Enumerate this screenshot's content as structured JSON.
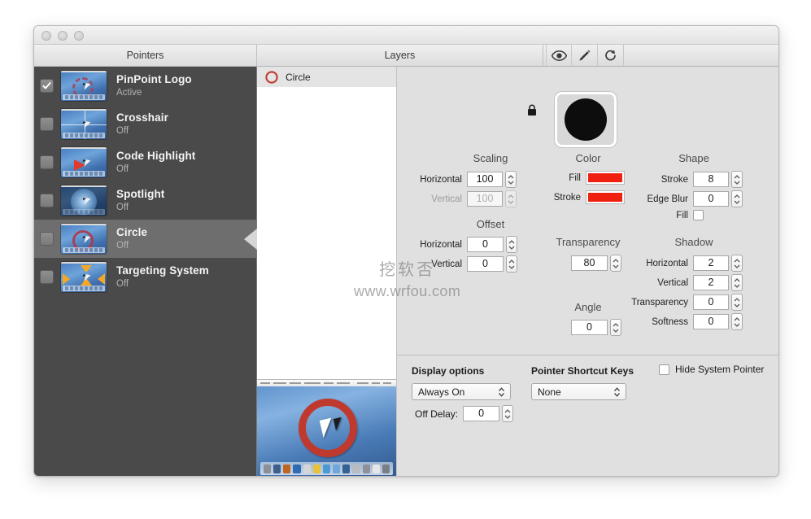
{
  "window": {
    "traffic_lights": [
      "close",
      "minimize",
      "zoom"
    ]
  },
  "header": {
    "pointers_title": "Pointers",
    "layers_title": "Layers",
    "tools": [
      {
        "name": "eye-icon",
        "label": "Preview"
      },
      {
        "name": "pencil-icon",
        "label": "Edit"
      },
      {
        "name": "reset-icon",
        "label": "Reset"
      }
    ]
  },
  "sidebar": {
    "pointers": [
      {
        "name": "PinPoint Logo",
        "state": "Active",
        "checked": true,
        "selected": false,
        "effect": "ring-dashed"
      },
      {
        "name": "Crosshair",
        "state": "Off",
        "checked": false,
        "selected": false,
        "effect": "crosshair"
      },
      {
        "name": "Code Highlight",
        "state": "Off",
        "checked": false,
        "selected": false,
        "effect": "arrow"
      },
      {
        "name": "Spotlight",
        "state": "Off",
        "checked": false,
        "selected": false,
        "effect": "spotlight"
      },
      {
        "name": "Circle",
        "state": "Off",
        "checked": false,
        "selected": true,
        "effect": "ring"
      },
      {
        "name": "Targeting System",
        "state": "Off",
        "checked": false,
        "selected": false,
        "effect": "targeting"
      }
    ]
  },
  "layers": {
    "items": [
      {
        "name": "Circle",
        "icon": "circle-outline-icon",
        "selected": true
      }
    ]
  },
  "inspector": {
    "scaling": {
      "title": "Scaling",
      "horizontal_label": "Horizontal",
      "horizontal_value": "100",
      "vertical_label": "Vertical",
      "vertical_value": "100",
      "vertical_disabled": true,
      "lock_icon": "lock-icon"
    },
    "offset": {
      "title": "Offset",
      "horizontal_label": "Horizontal",
      "horizontal_value": "0",
      "vertical_label": "Vertical",
      "vertical_value": "0"
    },
    "color": {
      "title": "Color",
      "fill_label": "Fill",
      "fill_color": "#F02010",
      "stroke_label": "Stroke",
      "stroke_color": "#F02010"
    },
    "transparency": {
      "title": "Transparency",
      "value": "80"
    },
    "angle": {
      "title": "Angle",
      "value": "0"
    },
    "shape": {
      "title": "Shape",
      "stroke_label": "Stroke",
      "stroke_value": "8",
      "edge_blur_label": "Edge Blur",
      "edge_blur_value": "0",
      "fill_label": "Fill",
      "fill_checked": false
    },
    "shadow": {
      "title": "Shadow",
      "horizontal_label": "Horizontal",
      "horizontal_value": "2",
      "vertical_label": "Vertical",
      "vertical_value": "2",
      "transparency_label": "Transparency",
      "transparency_value": "0",
      "softness_label": "Softness",
      "softness_value": "0"
    }
  },
  "options": {
    "display_options_title": "Display options",
    "display_mode_value": "Always On",
    "off_delay_label": "Off Delay:",
    "off_delay_value": "0",
    "shortcut_keys_title": "Pointer Shortcut Keys",
    "shortcut_keys_value": "None",
    "hide_system_pointer_label": "Hide System Pointer",
    "hide_system_pointer_checked": false
  },
  "watermark": {
    "cn": "挖软否",
    "url": "www.wrfou.com"
  }
}
